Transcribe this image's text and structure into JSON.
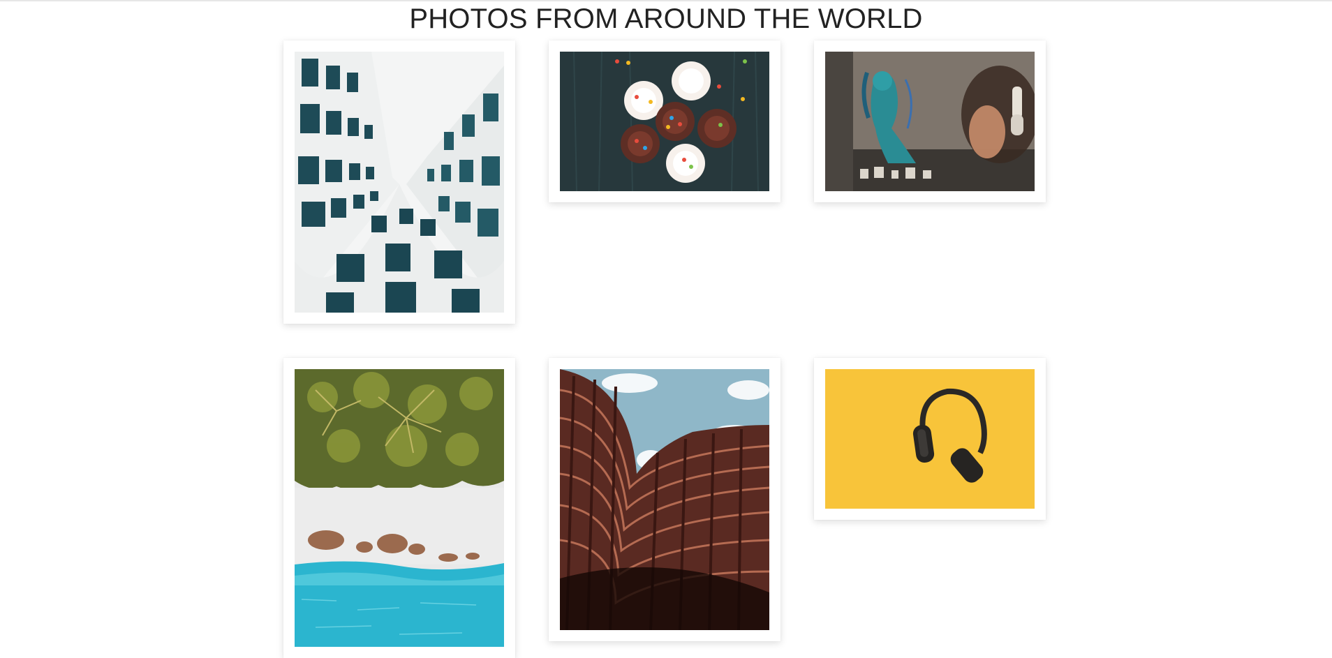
{
  "page": {
    "title": "PHOTOS FROM AROUND THE WORLD"
  },
  "gallery": {
    "photos": [
      {
        "subject": "looking-up-white-building-windows"
      },
      {
        "subject": "cupcakes-with-sprinkles"
      },
      {
        "subject": "street-graffiti-woman-with-headphones"
      },
      {
        "subject": "aerial-beach-palm-trees"
      },
      {
        "subject": "curved-red-building-facade"
      },
      {
        "subject": "headphones-on-yellow-background"
      }
    ]
  },
  "colors": {
    "title_text": "#222222",
    "card_background": "#ffffff",
    "page_background": "#ffffff"
  }
}
